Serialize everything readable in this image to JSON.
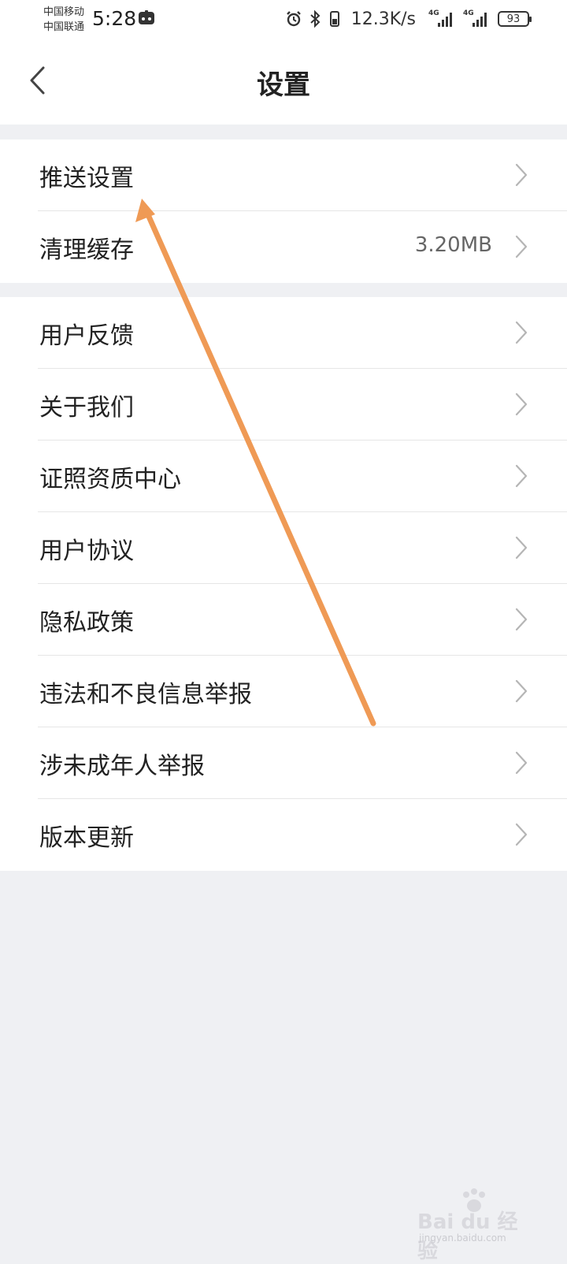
{
  "status_bar": {
    "carrier_1": "中国移动",
    "carrier_2": "中国联通",
    "time": "5:28",
    "network_speed": "12.3K/s",
    "sim_1_type": "4G",
    "sim_2_type": "4G",
    "battery_level": "93"
  },
  "header": {
    "title": "设置",
    "back_icon": "chevron-left-icon"
  },
  "groups": [
    {
      "items": [
        {
          "label": "推送设置",
          "value": ""
        },
        {
          "label": "清理缓存",
          "value": "3.20MB"
        }
      ]
    },
    {
      "items": [
        {
          "label": "用户反馈",
          "value": ""
        },
        {
          "label": "关于我们",
          "value": ""
        },
        {
          "label": "证照资质中心",
          "value": ""
        },
        {
          "label": "用户协议",
          "value": ""
        },
        {
          "label": "隐私政策",
          "value": ""
        },
        {
          "label": "违法和不良信息举报",
          "value": ""
        },
        {
          "label": "涉未成年人举报",
          "value": ""
        },
        {
          "label": "版本更新",
          "value": ""
        }
      ]
    }
  ],
  "annotation": {
    "color": "#ef9a55",
    "target": "推送设置"
  },
  "watermark": {
    "text": "Bai du 经验",
    "subtext": "jingyan.baidu.com"
  },
  "colors": {
    "page_background": "#eff0f3",
    "card_background": "#ffffff",
    "primary_text": "#222222",
    "secondary_text": "#666666",
    "chevron": "#b5b5b5"
  }
}
